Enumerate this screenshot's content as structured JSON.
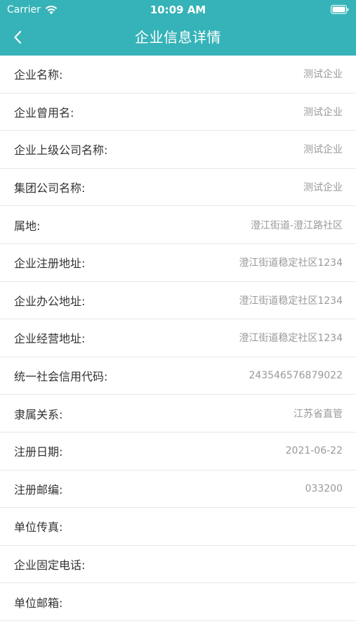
{
  "status_bar": {
    "carrier": "Carrier",
    "time": "10:09 AM"
  },
  "nav": {
    "title": "企业信息详情"
  },
  "rows": [
    {
      "label": "企业名称:",
      "value": "测试企业"
    },
    {
      "label": "企业曾用名:",
      "value": "测试企业"
    },
    {
      "label": "企业上级公司名称:",
      "value": "测试企业"
    },
    {
      "label": "集团公司名称:",
      "value": "测试企业"
    },
    {
      "label": "属地:",
      "value": "澄江街道-澄江路社区"
    },
    {
      "label": "企业注册地址:",
      "value": "澄江街道稳定社区1234"
    },
    {
      "label": "企业办公地址:",
      "value": "澄江街道稳定社区1234"
    },
    {
      "label": "企业经营地址:",
      "value": "澄江街道稳定社区1234"
    },
    {
      "label": "统一社会信用代码:",
      "value": "243546576879022"
    },
    {
      "label": "隶属关系:",
      "value": "江苏省直管"
    },
    {
      "label": "注册日期:",
      "value": "2021-06-22"
    },
    {
      "label": "注册邮编:",
      "value": "033200"
    },
    {
      "label": "单位传真:",
      "value": ""
    },
    {
      "label": "企业固定电话:",
      "value": ""
    },
    {
      "label": "单位邮箱:",
      "value": ""
    }
  ],
  "colors": {
    "header": "#36b3b8",
    "label": "#333333",
    "value": "#999999",
    "divider": "#e8e8e8"
  },
  "icons": {
    "wifi": "wifi-icon",
    "battery": "battery-icon",
    "back": "chevron-left-icon"
  }
}
